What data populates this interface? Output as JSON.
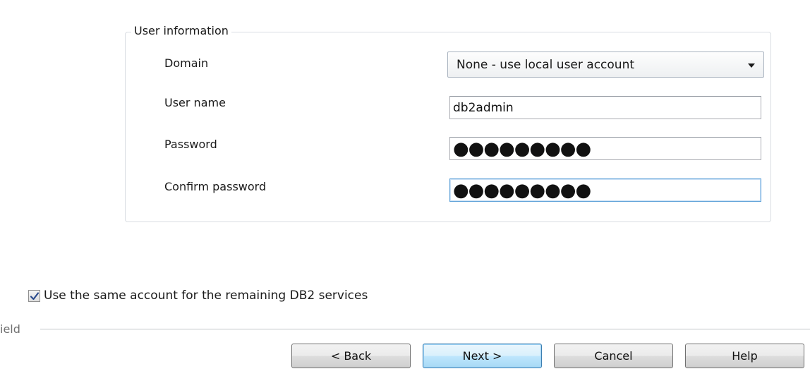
{
  "group": {
    "legend": "User information",
    "domain_label": "Domain",
    "domain_value": "None - use local user account",
    "username_label": "User name",
    "username_value": "db2admin",
    "password_label": "Password",
    "password_value": "●●●●●●●●●",
    "confirm_label": "Confirm password",
    "confirm_value": "●●●●●●●●●"
  },
  "checkbox": {
    "checked": true,
    "label": "Use the same account for the remaining DB2 services"
  },
  "footer": {
    "brand": "ield"
  },
  "buttons": {
    "back": "< Back",
    "next": "Next >",
    "cancel": "Cancel",
    "help": "Help"
  },
  "colors": {
    "default_button_border": "#3c7fb1",
    "focus_border": "#5ca0d8"
  }
}
